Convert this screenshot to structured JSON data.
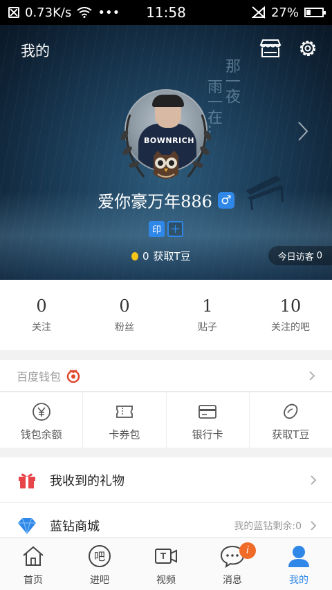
{
  "statusbar": {
    "network_speed": "0.73K/s",
    "time": "11:58",
    "battery": "27%"
  },
  "header": {
    "title": "我的"
  },
  "hero": {
    "poem_line1": "那一夜",
    "poem_line2": "雨一在...",
    "username": "爱你豪万年886",
    "gender_symbol": "♂",
    "badge_yin": "印",
    "badge_plus": "+",
    "tbeans_count": "0",
    "tbeans_label": "获取T豆",
    "visitors_label": "今日访客",
    "visitors_count": "0"
  },
  "avatar": {
    "text": "BOWNRICH"
  },
  "stats": [
    {
      "num": "0",
      "label": "关注"
    },
    {
      "num": "0",
      "label": "粉丝"
    },
    {
      "num": "1",
      "label": "贴子"
    },
    {
      "num": "10",
      "label": "关注的吧"
    }
  ],
  "wallet": {
    "title": "百度钱包",
    "items": [
      {
        "label": "钱包余额"
      },
      {
        "label": "卡券包"
      },
      {
        "label": "银行卡"
      },
      {
        "label": "获取T豆"
      }
    ]
  },
  "list": [
    {
      "label": "我收到的礼物",
      "sub": ""
    },
    {
      "label": "蓝钻商城",
      "sub": "我的蓝钻剩余:0"
    }
  ],
  "tabs": [
    {
      "label": "首页"
    },
    {
      "label": "进吧"
    },
    {
      "label": "视频"
    },
    {
      "label": "消息",
      "badge": "i"
    },
    {
      "label": "我的"
    }
  ],
  "colors": {
    "accent": "#2f87e8",
    "notify": "#f06b27"
  }
}
